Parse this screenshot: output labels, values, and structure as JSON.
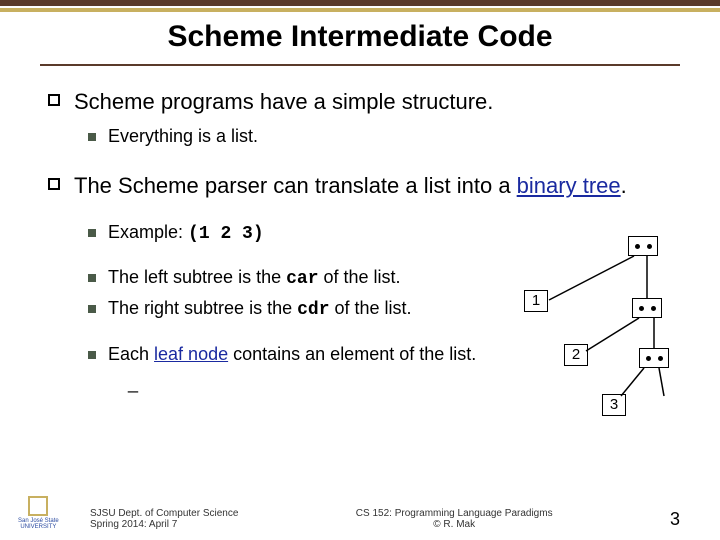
{
  "title": "Scheme Intermediate Code",
  "bullets": {
    "b1": "Scheme programs have a simple structure.",
    "b1a": "Everything is a list.",
    "b2_pre": "The Scheme parser can translate a list into a ",
    "b2_binary_tree": "binary tree",
    "b2_post": ".",
    "b2a_pre": "Example: ",
    "b2a_code": "(1 2 3)",
    "b2b_pre": "The left subtree is the ",
    "b2b_code": "car",
    "b2b_post": " of the list.",
    "b2c_pre": "The right subtree is the ",
    "b2c_code": "cdr",
    "b2c_post": " of the list.",
    "b2d_pre": "Each ",
    "b2d_leaf": "leaf node",
    "b2d_post": " contains an element of the list.",
    "b2d_sub": "_"
  },
  "tree": {
    "leaf1": "1",
    "leaf2": "2",
    "leaf3": "3"
  },
  "footer": {
    "left1": "SJSU Dept. of Computer Science",
    "left2": "Spring 2014: April 7",
    "center1": "CS 152: Programming Language Paradigms",
    "center2": "© R. Mak",
    "logo": "San José State",
    "logo2": "UNIVERSITY",
    "page": "3"
  }
}
